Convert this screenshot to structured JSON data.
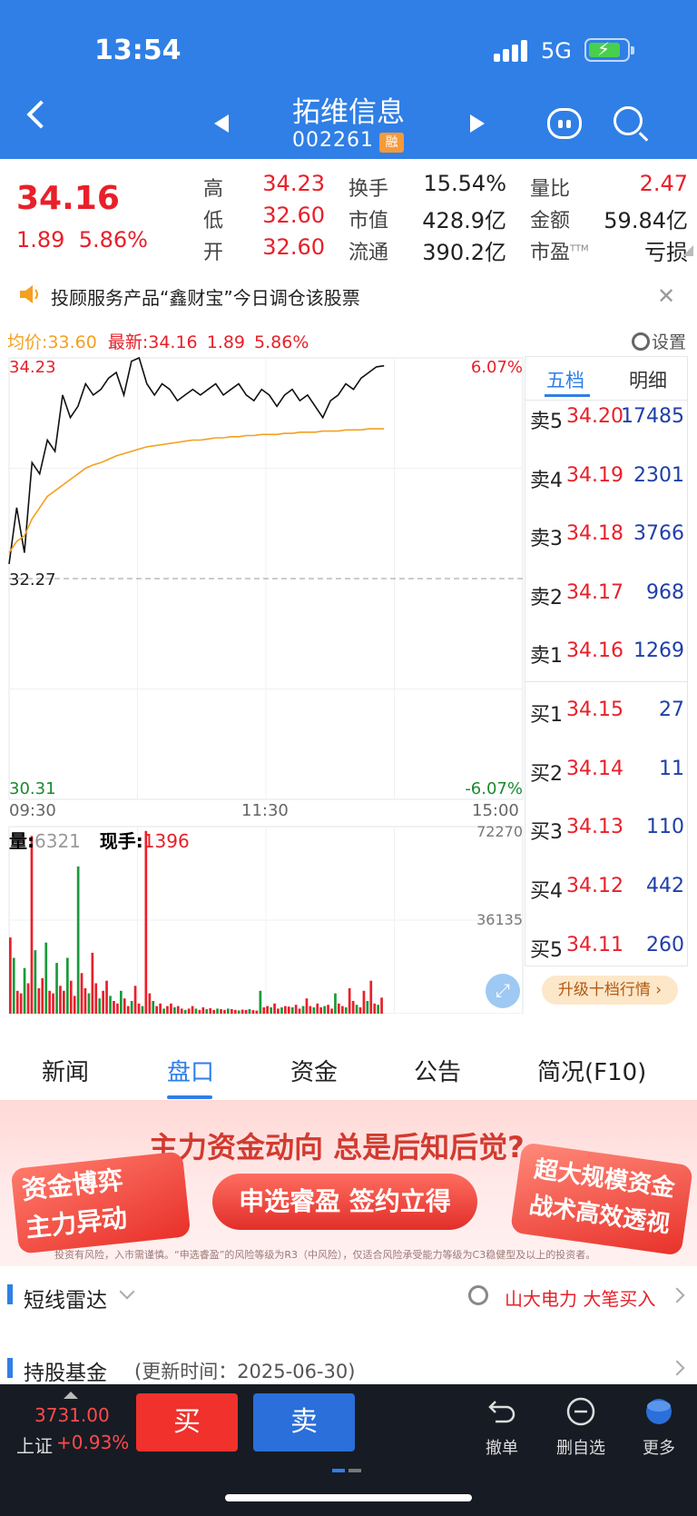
{
  "status": {
    "time": "13:54",
    "network": "5G"
  },
  "header": {
    "name": "拓维信息",
    "code": "002261",
    "badge": "融"
  },
  "quote": {
    "price": "34.16",
    "change": "1.89",
    "change_pct": "5.86%",
    "fields": [
      {
        "label": "高",
        "value": "34.23"
      },
      {
        "label": "低",
        "value": "32.60"
      },
      {
        "label": "开",
        "value": "32.60"
      },
      {
        "label": "换手",
        "value": "15.54%"
      },
      {
        "label": "市值",
        "value": "428.9亿"
      },
      {
        "label": "流通",
        "value": "390.2亿"
      },
      {
        "label": "量比",
        "value": "2.47"
      },
      {
        "label": "金额",
        "value": "59.84亿"
      },
      {
        "label": "市盈",
        "label_sup": "TTM",
        "value": "亏损"
      }
    ]
  },
  "notice": {
    "text": "投顾服务产品“鑫财宝”今日调仓该股票"
  },
  "chart": {
    "avg_label": "均价:33.60",
    "latest_label": "最新:34.16",
    "latest_change": "1.89",
    "latest_pct": "5.86%",
    "settings_label": "设置",
    "y_top": "34.23",
    "y_mid": "32.27",
    "y_bottom": "30.31",
    "pct_top": "6.07%",
    "pct_bottom": "-6.07%",
    "time_start": "09:30",
    "time_mid": "11:30",
    "time_end": "15:00",
    "vol_label": "量:",
    "vol_value": "6321",
    "hand_label": "现手:",
    "hand_value": "1396",
    "vol_max": "72270",
    "vol_mid": "36135"
  },
  "chart_data": {
    "type": "line",
    "y_range": [
      30.31,
      34.23
    ],
    "prev_close": 32.27,
    "x_range": [
      "09:30",
      "15:00"
    ],
    "series": [
      {
        "name": "最新",
        "color": "#111111",
        "values": [
          32.4,
          32.9,
          32.5,
          33.3,
          33.2,
          33.5,
          33.4,
          33.9,
          33.7,
          33.8,
          34.0,
          33.9,
          33.95,
          34.05,
          34.1,
          33.9,
          34.2,
          34.23,
          34.0,
          33.9,
          34.0,
          33.95,
          33.85,
          33.9,
          33.95,
          33.9,
          33.95,
          34.0,
          33.9,
          33.95,
          34.0,
          33.9,
          33.85,
          33.95,
          33.9,
          33.8,
          33.9,
          33.95,
          33.85,
          33.9,
          33.8,
          33.7,
          33.85,
          33.9,
          34.0,
          33.95,
          34.05,
          34.1,
          34.15,
          34.16
        ]
      },
      {
        "name": "均价",
        "color": "#f4a020",
        "values": [
          32.5,
          32.6,
          32.65,
          32.8,
          32.9,
          33.0,
          33.05,
          33.1,
          33.15,
          33.2,
          33.25,
          33.28,
          33.3,
          33.33,
          33.36,
          33.38,
          33.4,
          33.42,
          33.44,
          33.45,
          33.46,
          33.47,
          33.48,
          33.49,
          33.5,
          33.5,
          33.51,
          33.52,
          33.52,
          33.53,
          33.53,
          33.54,
          33.54,
          33.55,
          33.55,
          33.55,
          33.56,
          33.56,
          33.57,
          33.57,
          33.57,
          33.58,
          33.58,
          33.58,
          33.59,
          33.59,
          33.59,
          33.6,
          33.6,
          33.6
        ]
      }
    ],
    "volume_max": 72270,
    "volume": [
      30000,
      22000,
      9000,
      8000,
      18000,
      12000,
      70000,
      25000,
      10000,
      14000,
      28000,
      9000,
      8000,
      20000,
      11000,
      9000,
      22000,
      13000,
      7000,
      58000,
      16000,
      10000,
      8000,
      24000,
      12000,
      6000,
      9000,
      13000,
      7000,
      5000,
      4000,
      9000,
      6000,
      3000,
      5000,
      11000,
      4000,
      3000,
      72000,
      8000,
      5000,
      3000,
      4000,
      2000,
      3000,
      4000,
      2500,
      3000,
      2000,
      1500,
      2000,
      3000,
      2000,
      1500,
      2500,
      1800,
      2200,
      1500,
      2000,
      1800,
      1500,
      2000,
      1800,
      1500,
      1300,
      1600,
      1500,
      1800,
      1400,
      1200,
      9000,
      2500,
      3000,
      2500,
      4000,
      2000,
      2500,
      3000,
      2800,
      2500,
      3500,
      2000,
      3000,
      6000,
      3000,
      2500,
      4000,
      2500,
      3000,
      3500,
      2000,
      8000,
      4000,
      3000,
      2500,
      10000,
      5000,
      3500,
      2500,
      9000,
      5000,
      13000,
      4000,
      3500,
      6321
    ]
  },
  "orderbook": {
    "tabs": [
      "五档",
      "明细"
    ],
    "asks": [
      {
        "label": "卖5",
        "price": "34.20",
        "vol": "17485"
      },
      {
        "label": "卖4",
        "price": "34.19",
        "vol": "2301"
      },
      {
        "label": "卖3",
        "price": "34.18",
        "vol": "3766"
      },
      {
        "label": "卖2",
        "price": "34.17",
        "vol": "968"
      },
      {
        "label": "卖1",
        "price": "34.16",
        "vol": "1269"
      }
    ],
    "bids": [
      {
        "label": "买1",
        "price": "34.15",
        "vol": "27"
      },
      {
        "label": "买2",
        "price": "34.14",
        "vol": "11"
      },
      {
        "label": "买3",
        "price": "34.13",
        "vol": "110"
      },
      {
        "label": "买4",
        "price": "34.12",
        "vol": "442"
      },
      {
        "label": "买5",
        "price": "34.11",
        "vol": "260"
      }
    ],
    "upgrade": "升级十档行情 ›"
  },
  "tabs": [
    "新闻",
    "盘口",
    "资金",
    "公告",
    "简况(F10)"
  ],
  "banner": {
    "title": "主力资金动向 总是后知后觉?",
    "left_1": "资金博弈",
    "left_2": "主力异动",
    "cta": "申选睿盈 签约立得",
    "right_1": "超大规模资金",
    "right_2": "战术高效透视",
    "disclaimer": "投资有风险，入市需谨慎。“申选睿盈”的风险等级为R3（中风险），仅适合风险承受能力等级为C3稳健型及以上的投资者。"
  },
  "radar": {
    "title": "短线雷达",
    "right": "山大电力 大笔买入"
  },
  "funds": {
    "title": "持股基金",
    "update": "(更新时间：2025-06-30)"
  },
  "bottom": {
    "index_value": "3731.00",
    "index_name": "上证",
    "index_change": "+0.93%",
    "buy": "买",
    "sell": "卖",
    "actions": [
      "撤单",
      "删自选",
      "更多"
    ]
  }
}
